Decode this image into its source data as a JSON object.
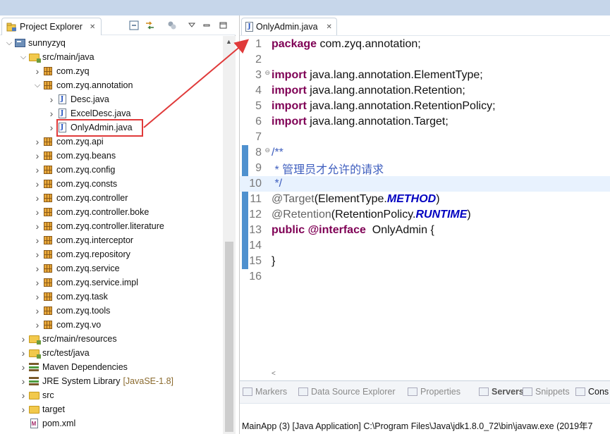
{
  "project_explorer": {
    "tab_title": "Project Explorer",
    "tab_close": "✕",
    "toolbar_icons": [
      "collapse-all-icon",
      "link-with-editor-icon",
      "filter-icon",
      "view-menu-icon",
      "minimize-icon",
      "maximize-icon"
    ],
    "tree": [
      {
        "label": "sunnyzyq",
        "icon": "project-icon",
        "arrow": "down"
      },
      {
        "label": "src/main/java",
        "icon": "source-folder-icon",
        "arrow": "down"
      },
      {
        "label": "com.zyq",
        "icon": "package-icon",
        "arrow": "right"
      },
      {
        "label": "com.zyq.annotation",
        "icon": "package-icon",
        "arrow": "down"
      },
      {
        "label": "Desc.java",
        "icon": "java-file-icon",
        "arrow": "right"
      },
      {
        "label": "ExcelDesc.java",
        "icon": "java-file-icon",
        "arrow": "right"
      },
      {
        "label": "OnlyAdmin.java",
        "icon": "java-file-icon",
        "arrow": "right"
      },
      {
        "label": "com.zyq.api",
        "icon": "package-icon",
        "arrow": "right"
      },
      {
        "label": "com.zyq.beans",
        "icon": "package-icon",
        "arrow": "right"
      },
      {
        "label": "com.zyq.config",
        "icon": "package-icon",
        "arrow": "right"
      },
      {
        "label": "com.zyq.consts",
        "icon": "package-icon",
        "arrow": "right"
      },
      {
        "label": "com.zyq.controller",
        "icon": "package-icon",
        "arrow": "right"
      },
      {
        "label": "com.zyq.controller.boke",
        "icon": "package-icon",
        "arrow": "right"
      },
      {
        "label": "com.zyq.controller.literature",
        "icon": "package-icon",
        "arrow": "right"
      },
      {
        "label": "com.zyq.interceptor",
        "icon": "package-icon",
        "arrow": "right"
      },
      {
        "label": "com.zyq.repository",
        "icon": "package-icon",
        "arrow": "right"
      },
      {
        "label": "com.zyq.service",
        "icon": "package-icon",
        "arrow": "right"
      },
      {
        "label": "com.zyq.service.impl",
        "icon": "package-icon",
        "arrow": "right"
      },
      {
        "label": "com.zyq.task",
        "icon": "package-icon",
        "arrow": "right"
      },
      {
        "label": "com.zyq.tools",
        "icon": "package-icon",
        "arrow": "right"
      },
      {
        "label": "com.zyq.vo",
        "icon": "package-icon",
        "arrow": "right"
      },
      {
        "label": "src/main/resources",
        "icon": "source-folder-icon",
        "arrow": "right"
      },
      {
        "label": "src/test/java",
        "icon": "source-folder-icon",
        "arrow": "right"
      },
      {
        "label": "Maven Dependencies",
        "icon": "library-icon",
        "arrow": "right"
      },
      {
        "label": "JRE System Library",
        "suffix": "[JavaSE-1.8]",
        "icon": "library-icon",
        "arrow": "right"
      },
      {
        "label": "src",
        "icon": "folder-icon",
        "arrow": "right"
      },
      {
        "label": "target",
        "icon": "folder-icon",
        "arrow": "right"
      },
      {
        "label": "pom.xml",
        "icon": "maven-file-icon",
        "arrow": ""
      }
    ]
  },
  "editor": {
    "tab_title": "OnlyAdmin.java",
    "tab_close": "✕",
    "lines": [
      {
        "num": "1",
        "parts": [
          [
            "kw",
            "package"
          ],
          [
            "",
            "com.zyq.annotation;"
          ]
        ]
      },
      {
        "num": "2",
        "parts": []
      },
      {
        "num": "3",
        "fold": "⊖",
        "parts": [
          [
            "kw",
            "import"
          ],
          [
            "",
            "java.lang.annotation.ElementType;"
          ]
        ]
      },
      {
        "num": "4",
        "parts": [
          [
            "kw",
            "import"
          ],
          [
            "",
            "java.lang.annotation.Retention;"
          ]
        ]
      },
      {
        "num": "5",
        "parts": [
          [
            "kw",
            "import"
          ],
          [
            "",
            "java.lang.annotation.RetentionPolicy;"
          ]
        ]
      },
      {
        "num": "6",
        "parts": [
          [
            "kw",
            "import"
          ],
          [
            "",
            "java.lang.annotation.Target;"
          ]
        ]
      },
      {
        "num": "7",
        "parts": []
      },
      {
        "num": "8",
        "fold": "⊖",
        "parts": [
          [
            "cm",
            "/**"
          ]
        ]
      },
      {
        "num": "9",
        "parts": [
          [
            "cm",
            " * 管理员才允许的请求"
          ]
        ]
      },
      {
        "num": "10",
        "current": true,
        "parts": [
          [
            "cm",
            " */"
          ]
        ]
      },
      {
        "num": "11",
        "parts": [
          [
            "an",
            "@Target"
          ],
          [
            "",
            "(ElementType."
          ],
          [
            "it",
            "METHOD"
          ],
          [
            "",
            ")"
          ]
        ]
      },
      {
        "num": "12",
        "parts": [
          [
            "an",
            "@Retention"
          ],
          [
            "",
            "(RetentionPolicy."
          ],
          [
            "it",
            "RUNTIME"
          ],
          [
            "",
            ")"
          ]
        ]
      },
      {
        "num": "13",
        "parts": [
          [
            "kw",
            "public"
          ],
          [
            "",
            " "
          ],
          [
            "kw",
            "@interface"
          ],
          [
            "",
            " OnlyAdmin {"
          ]
        ]
      },
      {
        "num": "14",
        "parts": []
      },
      {
        "num": "15",
        "parts": [
          [
            "",
            "}"
          ]
        ]
      },
      {
        "num": "16",
        "parts": []
      }
    ],
    "hscroll_arrow": "<"
  },
  "bottom_panel": {
    "tabs": [
      {
        "label": "Markers",
        "icon": "markers-icon"
      },
      {
        "label": "Data Source Explorer",
        "icon": "data-source-icon"
      },
      {
        "label": "Properties",
        "icon": "properties-icon"
      },
      {
        "label": "Servers",
        "icon": "servers-icon"
      },
      {
        "label": "Snippets",
        "icon": "snippets-icon"
      },
      {
        "label": "Cons",
        "icon": "console-icon"
      }
    ],
    "console_text": "MainApp (3) [Java Application] C:\\Program Files\\Java\\jdk1.8.0_72\\bin\\javaw.exe (2019年7"
  },
  "colors": {
    "keyword": "#7f0055",
    "comment": "#3f5fbf",
    "annotation": "#646464",
    "enum_constant": "#0000c0",
    "highlight_box": "#e03a3a",
    "arrow": "#e03a3a"
  }
}
